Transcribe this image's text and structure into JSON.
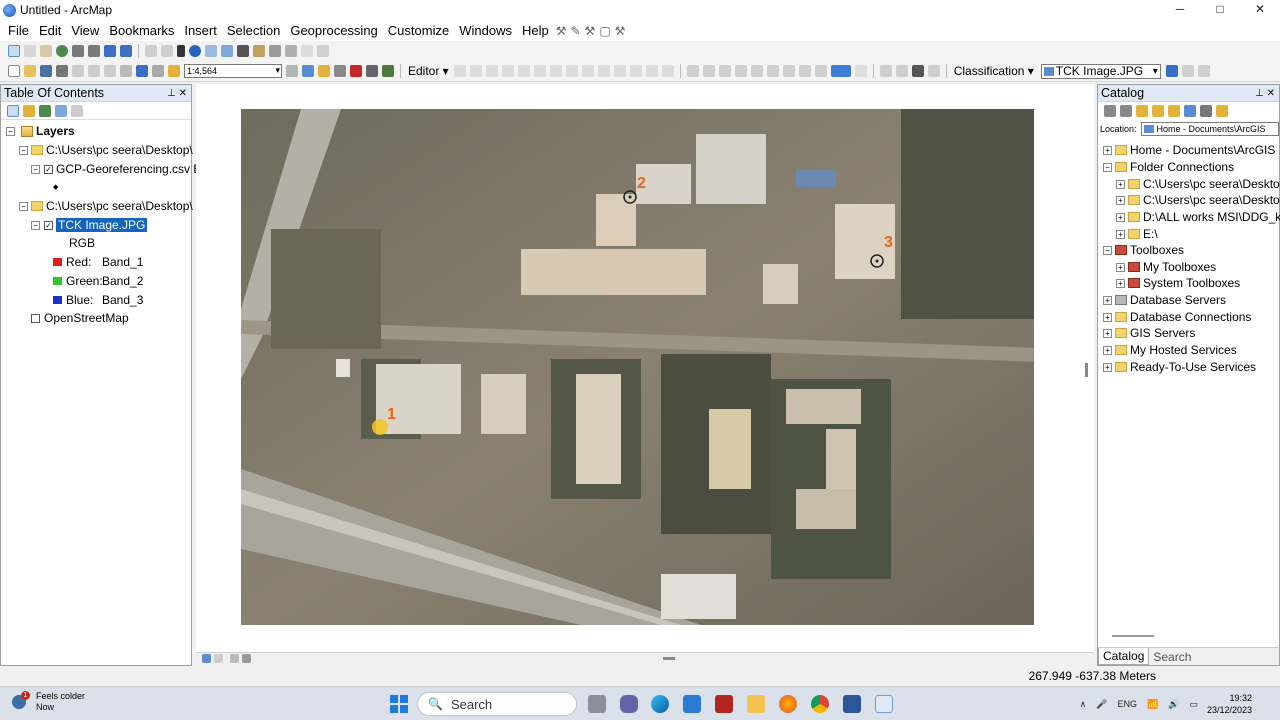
{
  "window": {
    "title": "Untitled - ArcMap",
    "controls": {
      "minimize": "─",
      "maximize": "□",
      "close": "✕"
    }
  },
  "menu": [
    "File",
    "Edit",
    "View",
    "Bookmarks",
    "Insert",
    "Selection",
    "Geoprocessing",
    "Customize",
    "Windows",
    "Help"
  ],
  "toolbar": {
    "scale": "1:4,564",
    "editor_label": "Editor ▾",
    "classification_label": "Classification ▾",
    "classification_layer": "TCK Image.JPG"
  },
  "toc": {
    "title": "Table Of Contents",
    "pin_icon": "pin-icon",
    "tree": {
      "layers": "Layers",
      "folder1": "C:\\Users\\pc seera\\Desktop\\",
      "gcp_layer": "GCP-Georeferencing.csv E",
      "gcp_symbol": "◆",
      "folder2": "C:\\Users\\pc seera\\Desktop\\",
      "tck_layer": "TCK Image.JPG",
      "rgb": "RGB",
      "red": "Red:",
      "red_band": "Band_1",
      "green": "Green:",
      "green_band": "Band_2",
      "blue": "Blue:",
      "blue_band": "Band_3",
      "osm": "OpenStreetMap"
    }
  },
  "map": {
    "gcp_labels": [
      "1",
      "2",
      "3"
    ],
    "colors": {
      "gcp_label": "#e8651a",
      "highlight": "#1565c0"
    }
  },
  "catalog": {
    "title": "Catalog",
    "location_label": "Location:",
    "location_value": "Home - Documents\\ArcGIS",
    "items": {
      "home": "Home - Documents\\ArcGIS",
      "folder_connections": "Folder Connections",
      "fc1": "C:\\Users\\pc seera\\Desktop",
      "fc2": "C:\\Users\\pc seera\\Desktop",
      "fc3": "D:\\ALL works MSI\\DDG_krl",
      "fc4": "E:\\",
      "toolboxes": "Toolboxes",
      "my_toolboxes": "My Toolboxes",
      "system_toolboxes": "System Toolboxes",
      "database_servers": "Database Servers",
      "database_connections": "Database Connections",
      "gis_servers": "GIS Servers",
      "hosted_services": "My Hosted Services",
      "ready_services": "Ready-To-Use Services"
    },
    "tabs": [
      "Catalog",
      "Search"
    ]
  },
  "status": {
    "coordinates": "267.949  -637.38 Meters"
  },
  "taskbar": {
    "weather_line1": "Feels colder",
    "weather_line2": "Now",
    "weather_badge": "1",
    "search_placeholder": "Search",
    "lang": "ENG",
    "time": "19:32",
    "date": "23/12/2023"
  }
}
